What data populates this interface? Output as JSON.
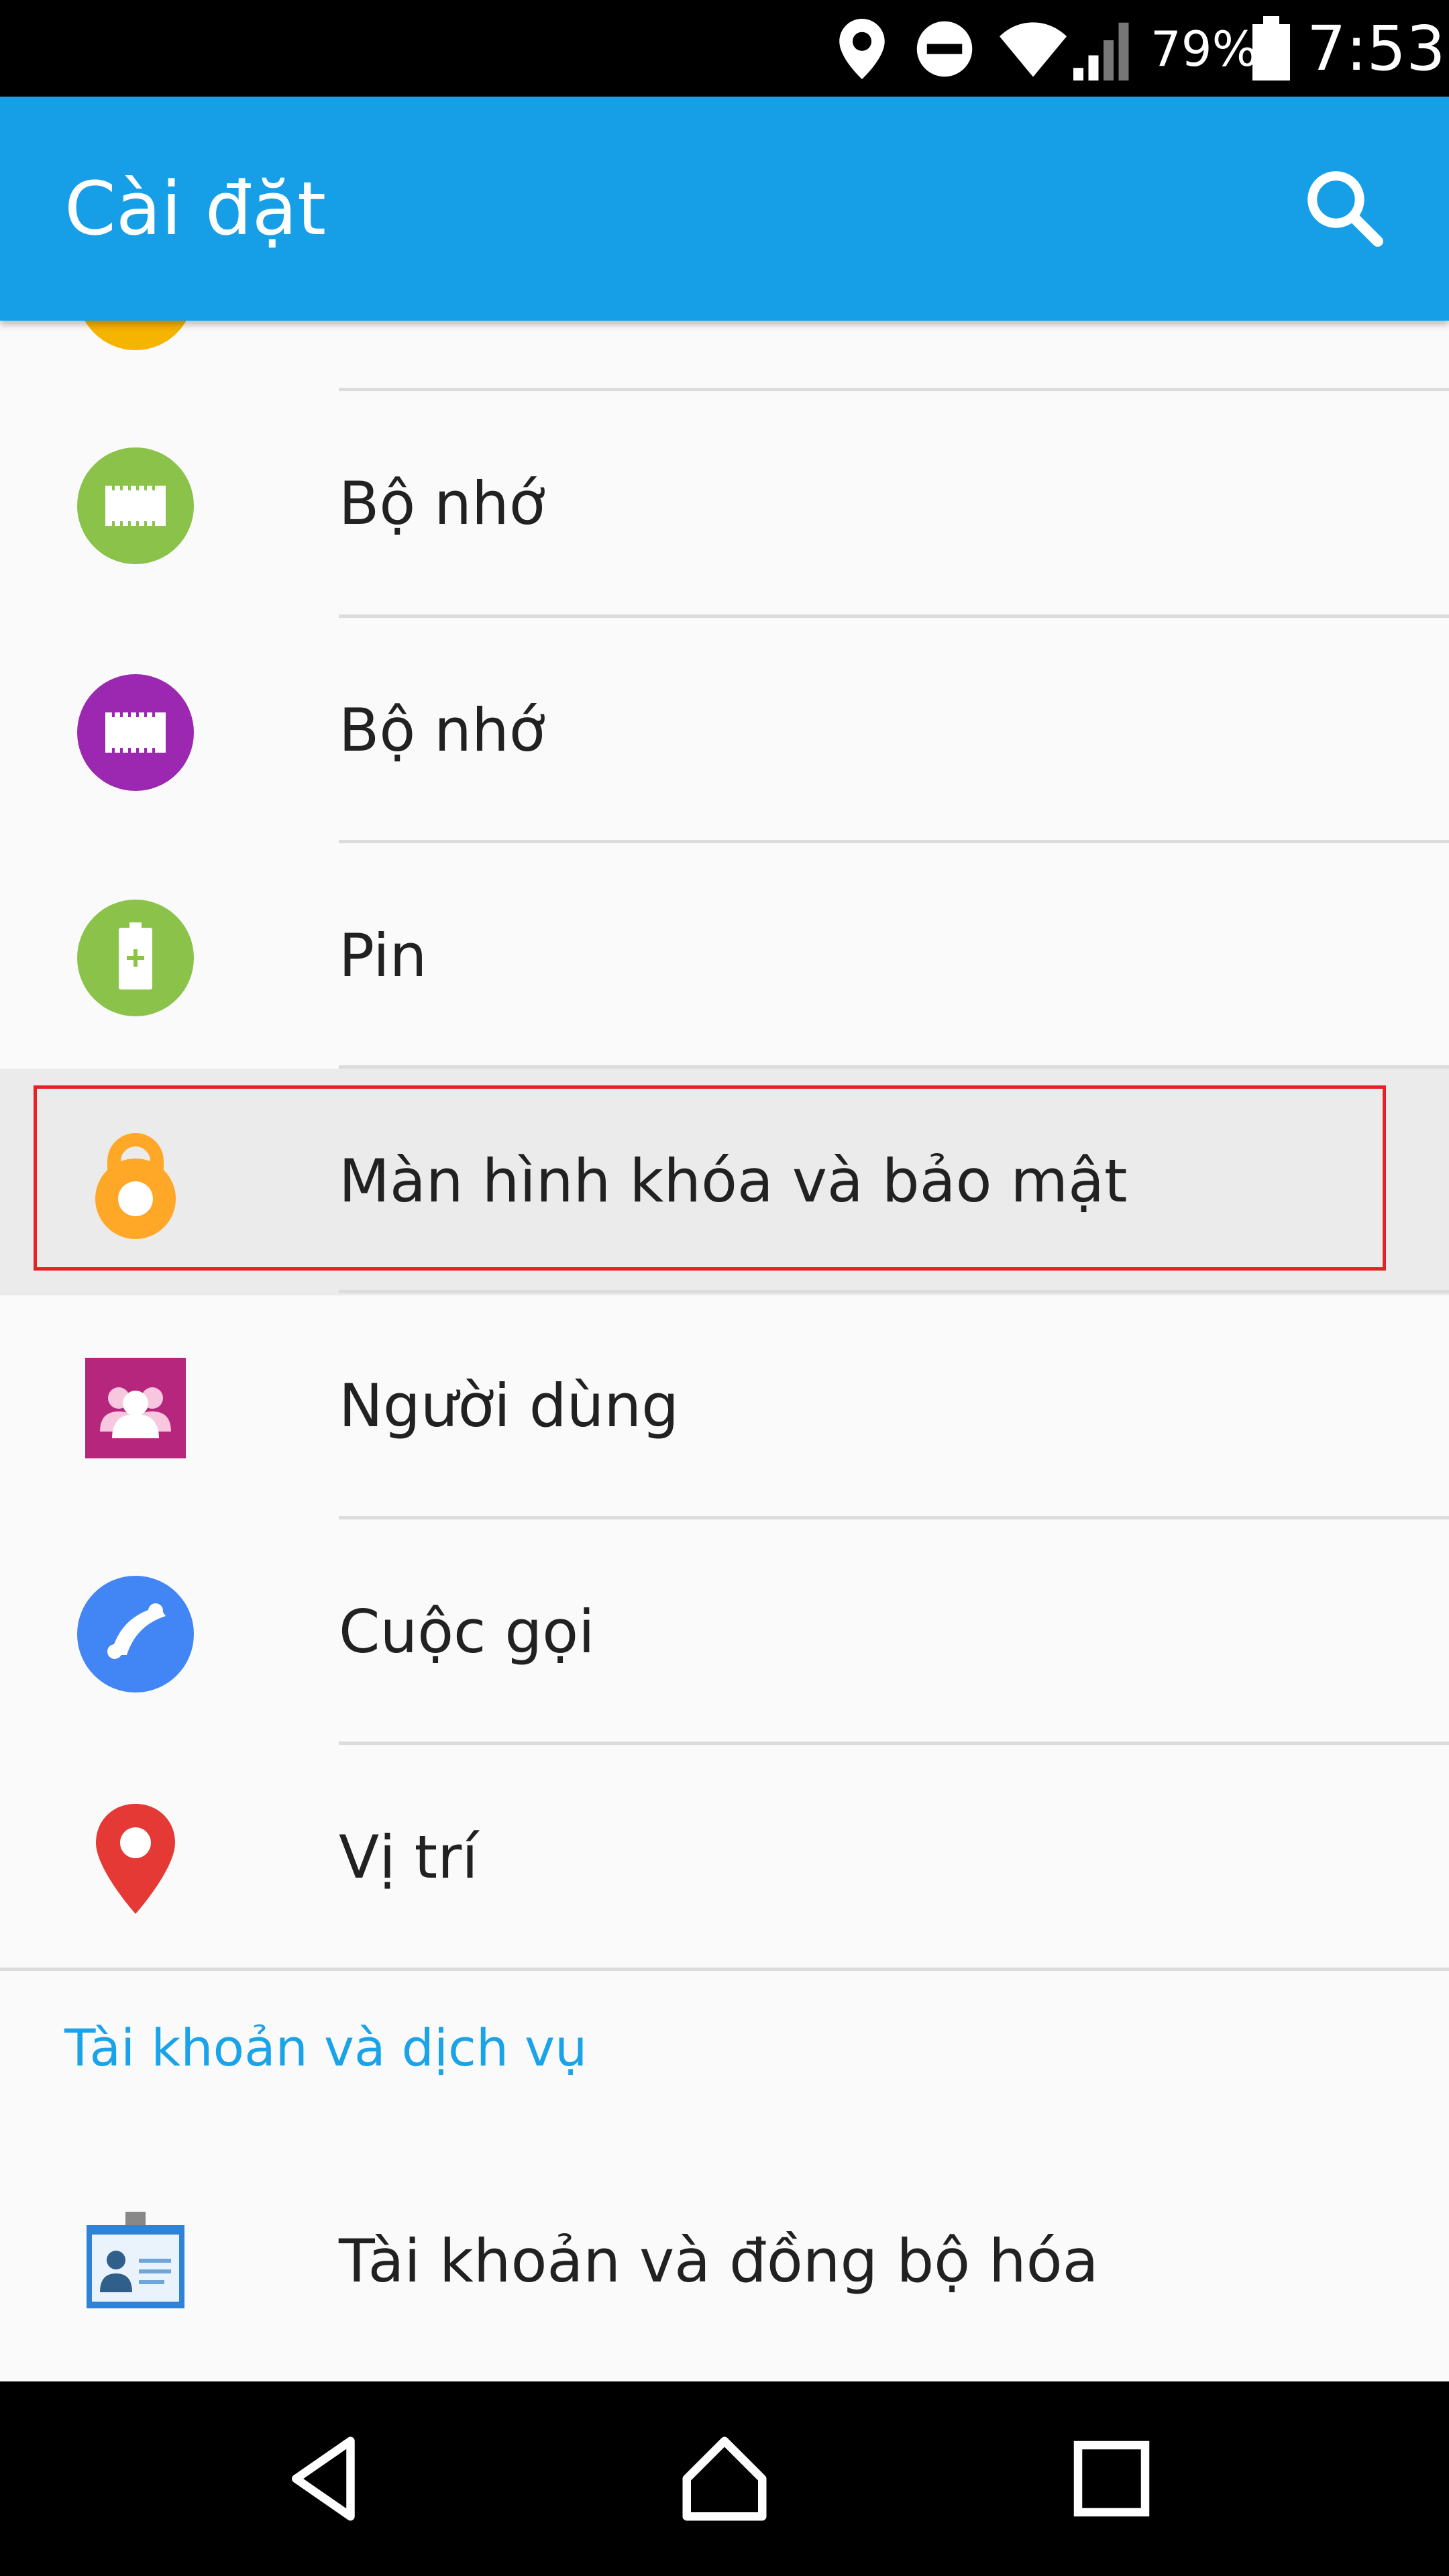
{
  "status_bar": {
    "battery": "79%",
    "time": "7:53",
    "icons": [
      "location-icon",
      "do-not-disturb-icon",
      "wifi-icon",
      "signal-icon",
      "battery-icon"
    ]
  },
  "app_bar": {
    "title": "Cài đặt",
    "search_icon": "search-icon"
  },
  "settings": {
    "items": [
      {
        "label": "Bộ nhớ",
        "icon": "memory-chip-icon",
        "color": "#8bc34a"
      },
      {
        "label": "Bộ nhớ",
        "icon": "memory-chip-icon",
        "color": "#9c27b0"
      },
      {
        "label": "Pin",
        "icon": "battery-plus-icon",
        "color": "#8bc34a"
      },
      {
        "label": "Màn hình khóa và bảo mật",
        "icon": "lock-icon",
        "color": "#ffa726",
        "highlighted": true
      },
      {
        "label": "Người dùng",
        "icon": "users-icon",
        "color": "#b5267c"
      },
      {
        "label": "Cuộc gọi",
        "icon": "phone-icon",
        "color": "#4285f4"
      },
      {
        "label": "Vị trí",
        "icon": "location-pin-icon",
        "color": "#e53935"
      }
    ],
    "section_header": "Tài khoản và dịch vụ",
    "accounts_item": {
      "label": "Tài khoản và đồng bộ hóa",
      "icon": "account-card-icon"
    }
  },
  "nav_bar": {
    "back": "back-icon",
    "home": "home-icon",
    "recents": "recents-icon"
  },
  "colors": {
    "app_bar": "#169ee7",
    "accent": "#1aa3e8",
    "highlight_border": "#e32227"
  }
}
